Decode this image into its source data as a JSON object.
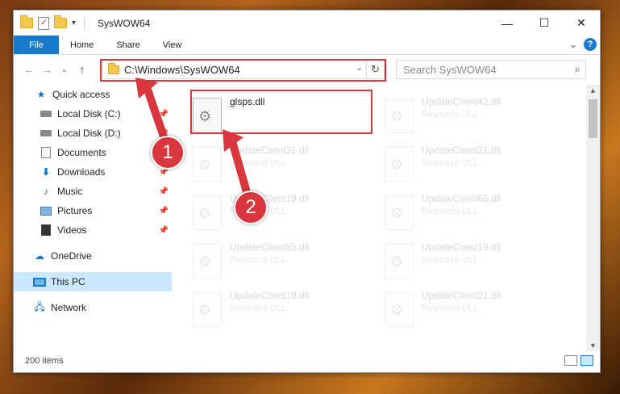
{
  "window": {
    "title": "SysWOW64",
    "minimize": "—",
    "maximize": "☐",
    "close": "✕"
  },
  "ribbon": {
    "tabs": [
      "File",
      "Home",
      "Share",
      "View"
    ],
    "expand": "⌄",
    "help": "?"
  },
  "nav": {
    "back": "←",
    "forward": "→",
    "recent": "⌄",
    "up": "↑",
    "address": "C:\\Windows\\SysWOW64",
    "dropdown": "⌄",
    "refresh": "↻",
    "search_placeholder": "Search SysWOW64",
    "search_icon": "⌕"
  },
  "sidebar": {
    "items": [
      {
        "label": "Quick access",
        "icon": "star-icon"
      },
      {
        "label": "Local Disk (C:)",
        "icon": "drive-icon",
        "pinned": true
      },
      {
        "label": "Local Disk (D:)",
        "icon": "drive-icon",
        "pinned": true
      },
      {
        "label": "Documents",
        "icon": "documents-icon",
        "pinned": true
      },
      {
        "label": "Downloads",
        "icon": "downloads-icon",
        "pinned": true
      },
      {
        "label": "Music",
        "icon": "music-icon",
        "pinned": true
      },
      {
        "label": "Pictures",
        "icon": "pictures-icon",
        "pinned": true
      },
      {
        "label": "Videos",
        "icon": "videos-icon",
        "pinned": true
      },
      {
        "label": "OneDrive",
        "icon": "cloud-icon"
      },
      {
        "label": "This PC",
        "icon": "pc-icon",
        "selected": true
      },
      {
        "label": "Network",
        "icon": "network-icon"
      }
    ]
  },
  "files": [
    {
      "name": "glsps.dll",
      "type": "",
      "faded": false
    },
    {
      "name": "UpdateClient42.dll",
      "type": "Resource DLL",
      "faded": true
    },
    {
      "name": "UpdateClient21.dll",
      "type": "Resource DLL",
      "faded": true
    },
    {
      "name": "UpdateClient21.dll",
      "type": "Resource DLL",
      "faded": true
    },
    {
      "name": "UpdateClient19.dll",
      "type": "Resource DLL",
      "faded": true
    },
    {
      "name": "UpdateClient65.dll",
      "type": "Resource DLL",
      "faded": true
    },
    {
      "name": "UpdateClient65.dll",
      "type": "Resource DLL",
      "faded": true
    },
    {
      "name": "UpdateClient19.dll",
      "type": "Resource DLL",
      "faded": true
    },
    {
      "name": "UpdateClient19.dll",
      "type": "Resource DLL",
      "faded": true
    },
    {
      "name": "UpdateClient21.dll",
      "type": "Resource DLL",
      "faded": true
    }
  ],
  "status": {
    "count": "200 items"
  },
  "annotations": {
    "marker1": "1",
    "marker2": "2"
  },
  "colors": {
    "accent": "#1979ca",
    "highlight": "#d9363e",
    "selected_bg": "#cce8ff"
  }
}
